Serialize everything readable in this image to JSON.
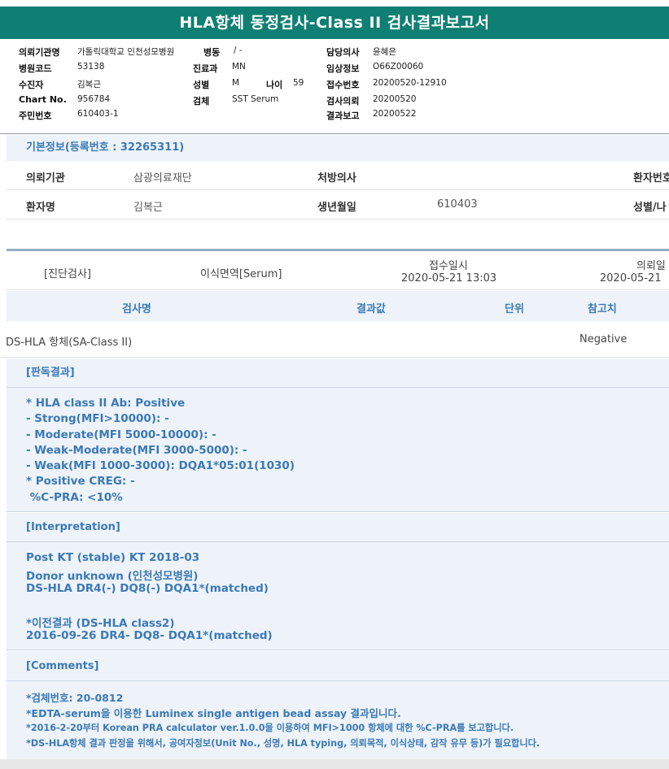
{
  "title": "HLA항체 동정검사-Class II 검사결과보고서",
  "header": {
    "institution_label": "의뢰기관명",
    "institution_value": "가톨릭대학교 인천성모병원",
    "ward_label": "병동",
    "ward_value": "/ -",
    "doctor_label": "담당의사",
    "doctor_value": "윤혜은",
    "hospital_code_label": "병원코드",
    "hospital_code_value": "53138",
    "dept_label": "진료과",
    "dept_value": "MN",
    "clinical_info_label": "임상정보",
    "clinical_info_value": "O66Z00060",
    "patient_label": "수진자",
    "patient_value": "김복근",
    "sex_label": "성별",
    "sex_value": "M",
    "age_label": "나이",
    "age_value": "59",
    "receipt_no_label": "접수번호",
    "receipt_no_value": "20200520-12910",
    "chart_label": "Chart No.",
    "chart_value": "956784",
    "specimen_label": "검체",
    "specimen_value": "SST Serum",
    "test_request_label": "검사의뢰",
    "test_request_value": "20200520",
    "resident_label": "주민번호",
    "resident_value": "610403-1",
    "report_label": "결과보고",
    "report_value": "20200522"
  },
  "basic": {
    "title": "기본정보(등록번호 : 32265311)",
    "row1": {
      "inst_label": "의뢰기관",
      "inst_value": "삼광의료재단",
      "doctor_label": "처방의사",
      "patient_no_label": "환자번호"
    },
    "row2": {
      "name_label": "환자명",
      "name_value": "김복근",
      "birth_label": "생년월일",
      "birth_value": "610403",
      "sex_age_label": "성별/나"
    }
  },
  "info": {
    "category": "[진단검사]",
    "subcategory": "이식면역[Serum]",
    "receipt_label": "접수일시",
    "receipt_value": "2020-05-21 13:03",
    "request_label": "의뢰일",
    "request_value": "2020-05-21"
  },
  "table": {
    "headers": {
      "test": "검사명",
      "result": "결과값",
      "unit": "단위",
      "ref": "참고치"
    },
    "row": {
      "test": "DS-HLA 항체(SA-Class II)",
      "result": "",
      "unit": "",
      "ref": "Negative"
    }
  },
  "judgement": {
    "title": "[판독결과]",
    "lines": [
      "* HLA class II Ab: Positive",
      "- Strong(MFI>10000): -",
      "- Moderate(MFI 5000-10000): -",
      "- Weak-Moderate(MFI 3000-5000): -",
      "- Weak(MFI 1000-3000): DQA1*05:01(1030)",
      "* Positive CREG: -",
      " %C-PRA: <10%"
    ]
  },
  "interpretation": {
    "title": "[Interpretation]",
    "lines": [
      "Post KT (stable) KT 2018-03",
      "Donor unknown (인천성모병원)",
      "DS-HLA DR4(-) DQ8(-) DQA1*(matched)",
      "",
      "*이전결과 (DS-HLA class2)",
      "2016-09-26 DR4- DQ8- DQA1*(matched)"
    ]
  },
  "comments": {
    "title": "[Comments]",
    "lines": [
      "*검체번호: 20-0812",
      "*EDTA-serum을 이용한 Luminex single antigen bead assay 결과입니다.",
      "*2016-2-20부터 Korean PRA calculator ver.1.0.0을 이용하여 MFI>1000 항체에 대한 %C-PRA를 보고합니다.",
      "*DS-HLA항체 결과 판정을 위해서, 공여자정보(Unit No., 성명, HLA typing, 의뢰목적, 이식상태, 감작 유무 등)가 필요합니다."
    ]
  },
  "colors": {
    "teal": "#0f7f73",
    "accent_blue": "#3a79b7",
    "panel_bg": "#eef3f9"
  }
}
